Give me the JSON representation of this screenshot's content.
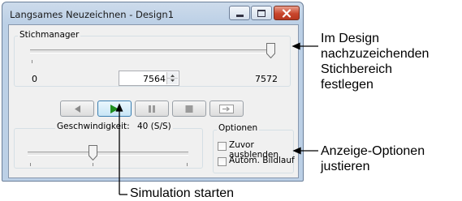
{
  "window": {
    "title": "Langsames Neuzeichnen - Design1"
  },
  "stitch_manager": {
    "label": "Stichmanager",
    "slider_level_fraction": 0.999,
    "min_label": "0",
    "current_value": "7564",
    "max_label": "7572"
  },
  "playback": {
    "buttons": [
      "rewind-icon",
      "play-icon",
      "pause-icon",
      "stop-icon",
      "jump-icon"
    ]
  },
  "speed": {
    "label": "Geschwindigkeit:",
    "value": "40 (S/S)",
    "slider_level_fraction": 0.43
  },
  "options": {
    "label": "Optionen",
    "hide_before": {
      "label": "Zuvor ausblenden",
      "checked": false
    },
    "auto_scroll": {
      "label": "Autom. Bildlauf",
      "checked": false
    }
  },
  "callouts": {
    "range_line1": "Im Design",
    "range_line2": "nachzuzeichenden",
    "range_line3": "Stichbereich",
    "range_line4": "festlegen",
    "display_line1": "Anzeige-Optionen",
    "display_line2": "justieren",
    "simulation": "Simulation starten"
  },
  "colors": {
    "accent_play": "#1f8f1f",
    "close_button": "#c9462c"
  }
}
